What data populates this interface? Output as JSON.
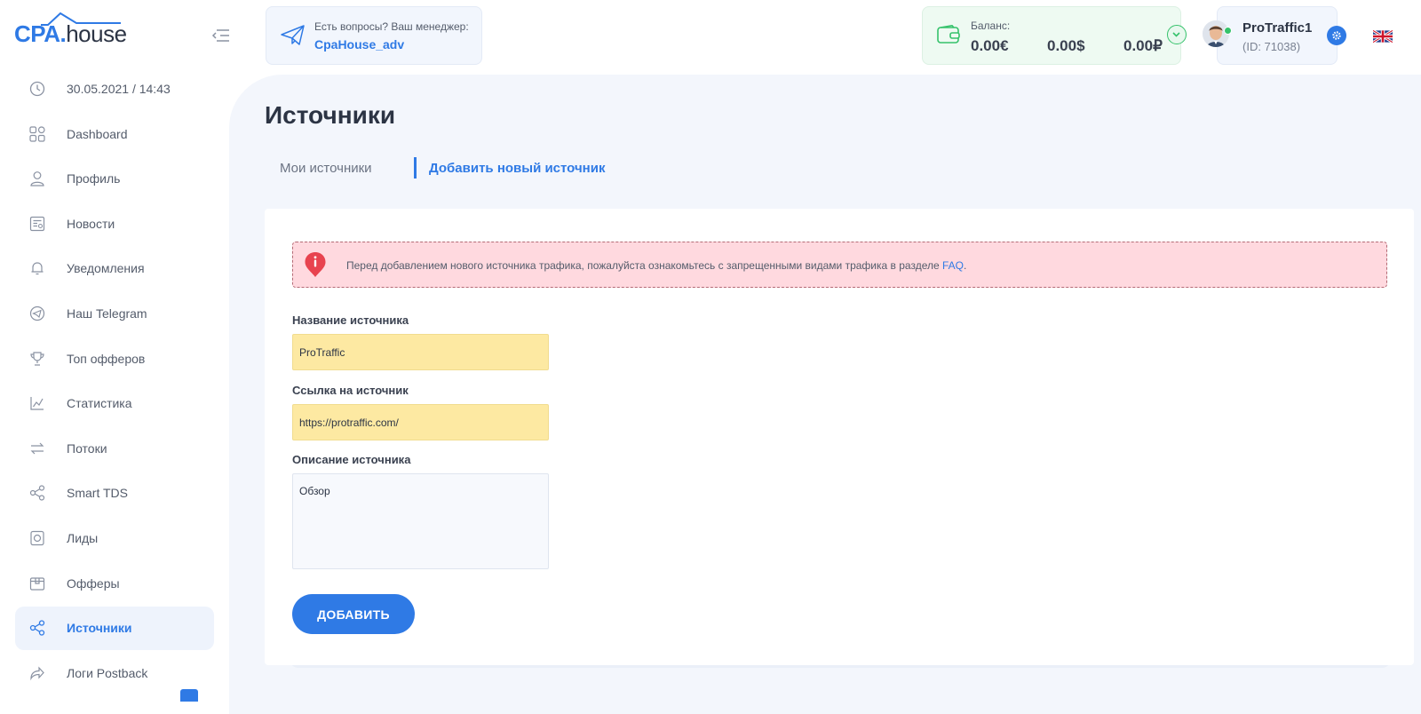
{
  "logo": {
    "part1": "CPA",
    "part2": ".",
    "part3": "house"
  },
  "header": {
    "help_question": "Есть вопросы? Ваш менеджер:",
    "manager": "CpaHouse_adv",
    "balance_label": "Баланс:",
    "balance_eur": "0.00€",
    "balance_usd": "0.00$",
    "balance_rub": "0.00₽",
    "user_name": "ProTraffic1",
    "user_id": "(ID: 71038)",
    "language": "EN"
  },
  "sidebar": {
    "datetime": "30.05.2021 / 14:43",
    "items": [
      {
        "label": "Dashboard",
        "icon": "grid-icon"
      },
      {
        "label": "Профиль",
        "icon": "user-icon"
      },
      {
        "label": "Новости",
        "icon": "news-icon"
      },
      {
        "label": "Уведомления",
        "icon": "bell-icon"
      },
      {
        "label": "Наш Telegram",
        "icon": "telegram-icon"
      },
      {
        "label": "Топ офферов",
        "icon": "trophy-icon"
      },
      {
        "label": "Статистика",
        "icon": "chart-icon"
      },
      {
        "label": "Потоки",
        "icon": "arrows-icon"
      },
      {
        "label": "Smart TDS",
        "icon": "share-icon"
      },
      {
        "label": "Лиды",
        "icon": "coin-icon"
      },
      {
        "label": "Офферы",
        "icon": "box-icon"
      },
      {
        "label": "Источники",
        "icon": "share-icon",
        "active": true
      },
      {
        "label": "Логи Postback",
        "icon": "forward-icon"
      }
    ]
  },
  "page": {
    "title": "Источники",
    "tabs": [
      {
        "label": "Мои источники"
      },
      {
        "label": "Добавить новый источник",
        "active": true
      }
    ],
    "alert_text": "Перед добавлением нового источника трафика, пожалуйста ознакомьтесь с запрещенными видами трафика в разделе ",
    "alert_link": "FAQ",
    "alert_end": ".",
    "form": {
      "name_label": "Название источника",
      "name_value": "ProTraffic",
      "url_label": "Ссылка на источник",
      "url_value": "https://protraffic.com/",
      "desc_label": "Описание источника",
      "desc_value": "Обзор",
      "submit": "ДОБАВИТЬ"
    }
  },
  "colors": {
    "accent": "#2f7ae5",
    "success": "#35c26b",
    "alert_bg": "#ffd9df",
    "autofill": "#fde9a2"
  }
}
